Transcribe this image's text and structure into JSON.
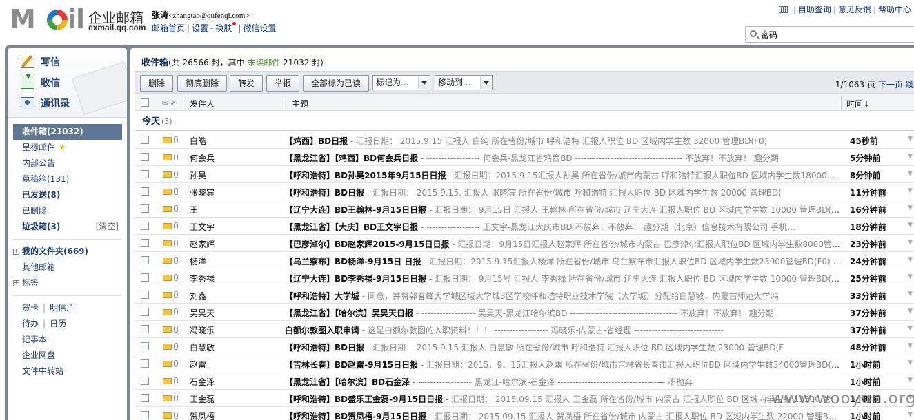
{
  "header": {
    "logo_text": "MOil",
    "brand_cn": "企业邮箱",
    "brand_en": "exmail.qq.com",
    "user_name": "张涛",
    "user_email": "<zhangtao@qufenqi.com>",
    "links": [
      "邮箱首页",
      "设置",
      "换肤",
      "微信设置"
    ],
    "top_links": [
      "自助查询",
      "意见反馈",
      "帮助中心"
    ],
    "search_value": "密码"
  },
  "nav": {
    "quick": [
      "写信",
      "收信",
      "通讯录"
    ],
    "inbox": "收件箱(21032)",
    "starred": "星标邮件",
    "announce": "内部公告",
    "drafts": "草稿箱(131)",
    "sent": "已发送(8)",
    "deleted": "已删除",
    "trash": "垃圾箱(3)",
    "clear": "[清空]",
    "my_folders": "我的文件夹(669)",
    "other_mail": "其他邮箱",
    "tags": "标签",
    "card": "贺卡",
    "postcard": "明信片",
    "todo": "待办",
    "calendar": "日历",
    "notes": "记事本",
    "netdisk": "企业网盘",
    "transfer": "文件中转站"
  },
  "main": {
    "title": "收件箱",
    "count_prefix": "(共 26566 封，其中 ",
    "unread_label": "未读邮件",
    "count_suffix": " 21032 封)",
    "buttons": {
      "delete": "删除",
      "delete_perm": "彻底删除",
      "forward": "转发",
      "report": "举报",
      "mark_all_read": "全部标为已读"
    },
    "mark_as": "标记为...",
    "move_to": "移动到...",
    "pager_text": "1/1063 页",
    "next_page": "下一页",
    "jump": "跳",
    "col_from": "发件人",
    "col_subject": "主题",
    "col_time": "时间↓",
    "today_label": "今天",
    "today_count": "(3)"
  },
  "emails": [
    {
      "from": "白皓",
      "subject": "【鸡西】BD日报",
      "preview": " - 汇报日期： 2015.9.15 汇报人 白纯 所在省份/城市 呼和浩特 汇报人职位 BD 区域内学生数 32000 管理BD(F0)",
      "time": "45秒前"
    },
    {
      "from": "何会兵",
      "subject": "【黑龙江省】【鸡西】BD何会兵日报",
      "preview": " - ------------------ 何会兵-黑龙江省鸡西BD ------------------------------------ 不放弃！不放弃！ 趣分期",
      "time": "5分钟前"
    },
    {
      "from": "孙昊",
      "subject": "【呼和浩特】BD孙昊2015年9月15日日报",
      "preview": " - 汇报日期：2015.9.15汇报人孙昊 所在省份/城市内蒙古 呼和浩特汇报人职位BD 区域内学生数18000管理BD(F0)",
      "time": "8分钟前"
    },
    {
      "from": "张晓宾",
      "subject": "【呼和浩特】BD日报",
      "preview": " - 汇报日期： 2015.9.15. 汇报人 张晓宾 所在省份/城市 呼和浩特 汇报人职位 BD 区域内学生数 20000 管理BD(",
      "time": "11分钟前"
    },
    {
      "from": "王",
      "subject": "【辽宁大连】BD王翰林-9月15日日报",
      "preview": " - 汇报日期： 9月15日 汇报人 王翰林 所在省份/城市 辽宁大连 汇报人职位 BD 区域内学生数 10000 管理BD(F0)",
      "time": "16分钟前"
    },
    {
      "from": "王文宇",
      "subject": "【黑龙江省】【大庆】BD王文宇日报",
      "preview": " - ------------------ 王文宇-黑龙江大庆市BD 不放弃！不放弃！ 趣分期（北京）信息技术有限公司 手机…",
      "time": "18分钟前"
    },
    {
      "from": "赵家辉",
      "subject": "【巴彦淖尔】BD赵家辉2015-9月15日日报",
      "preview": " - 汇报日期：9月15日汇报人赵家辉 所在省份/城市内蒙古 巴彦淖尔汇报人职位BD 区域内学生数8000管理BD(F…",
      "time": "23分钟前"
    },
    {
      "from": "杨洋",
      "subject": "【乌兰察布】BD杨洋-9月15日 日报",
      "preview": " - 汇报日期：2015.9.15汇报人杨洋 所在省份/城市 乌兰察布市汇报人职位BD 区域内学生数23900管理BD(F0) 人数4",
      "time": "24分钟前"
    },
    {
      "from": "李秀禄",
      "subject": "【辽宁大连】BD李秀禄-9月15日日报",
      "preview": " - 汇报日期： 9月15号 汇报人 李秀禄 所在省份/城市 辽宁大连 汇报人职位 BD 区域内学生数 10000 管理BD(F0)",
      "time": "25分钟前"
    },
    {
      "from": "刘鑫",
      "subject": "【呼和浩特】大学城",
      "preview": " - 同意，并将郭春峰大学城区域大学城3区学校呼和浩特职业技术学院（大学城）分配给白慧敏，内蒙古师范大学鸿",
      "time": "33分钟前"
    },
    {
      "from": "吴昊天",
      "subject": "【黑龙江省】【哈尔滨】吴昊天日报",
      "preview": " - ------------------ 吴昊天-黑龙江哈尔滨BD ------------------------------------ 不放弃！不放弃！ 趣分期",
      "time": "37分钟前"
    },
    {
      "from": "冯晓乐",
      "subject": "白额尔敦图入职申请",
      "preview": " - 这是白额尔敦图的入职资料！！！ ------------------ 冯晓乐-内蒙古-省经理 ------------------------------",
      "time": "37分钟前"
    },
    {
      "from": "白慧敏",
      "subject": "【呼和浩特】BD日报",
      "preview": " - 汇报日期： 2015.9.15 汇报人 白慧敏 所在省份/城市 呼和浩特 汇报人职位 BD 区域内学生数 23000 管理BD(F",
      "time": "48分钟前"
    },
    {
      "from": "赵雷",
      "subject": "【吉林长春】BD赵雷-9月15日日报",
      "preview": " - 汇报日期：2015、9、15汇报人赵雷 所在省份/城市吉林省长春市汇报人职位BD 区域内学生数34000管理BD(F0)人",
      "time": "1小时前"
    },
    {
      "from": "石金泽",
      "subject": "【黑龙江省】【哈尔滨】BD石金泽",
      "preview": " - ------------------ 黑龙江-哈尔滨-石金泽 ------------------------------------ 不抛弃",
      "time": "1小时前"
    },
    {
      "from": "王金磊",
      "subject": "【呼和浩特】BD盛乐王金磊-9月15日日报",
      "preview": " - 汇报日期： 2015.09.15 汇报人 王金磊 所在省份/城市 内蒙古 汇报人职位 BD 区域内学生数 13500 管理BD",
      "time": "1小时前"
    },
    {
      "from": "贺凤梧",
      "subject": "【呼和浩特】BD贺凤梧-9月15日日报",
      "preview": " - 汇报日期： 2015.09.15 汇报人 贺凤梧 所在省份/城市 内蒙古 汇报人职位 BD 区域内学生数 22000 管理BD(F",
      "time": "1小时前"
    }
  ],
  "watermark": "www.wooyun.org"
}
